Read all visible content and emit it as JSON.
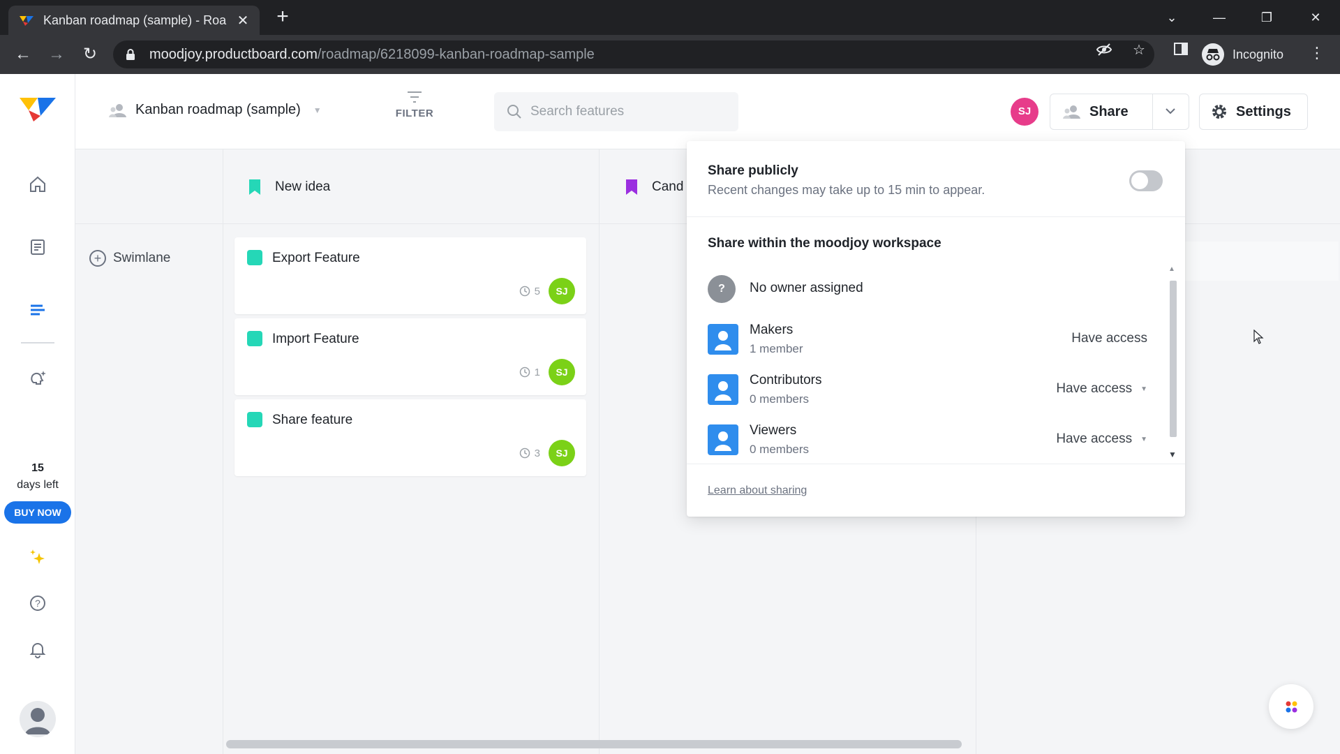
{
  "browser": {
    "tab_title": "Kanban roadmap (sample) - Roa",
    "url_host": "moodjoy.productboard.com",
    "url_path": "/roadmap/6218099-kanban-roadmap-sample",
    "incognito_label": "Incognito"
  },
  "sidebar": {
    "trial_days": "15",
    "trial_left": "days left",
    "buy_now": "BUY NOW"
  },
  "header": {
    "roadmap_title": "Kanban roadmap (sample)",
    "filter_label": "FILTER",
    "search_placeholder": "Search features",
    "avatar_initials": "SJ",
    "share_label": "Share",
    "settings_label": "Settings"
  },
  "board": {
    "add_swimlane": "Swimlane",
    "columns": [
      {
        "label": "New idea",
        "color": "#25d7b7"
      },
      {
        "label": "Cand",
        "color": "#9b2fe0"
      }
    ],
    "cards": [
      {
        "title": "Export Feature",
        "count": "5",
        "avatar": "SJ"
      },
      {
        "title": "Import Feature",
        "count": "1",
        "avatar": "SJ"
      },
      {
        "title": "Share feature",
        "count": "3",
        "avatar": "SJ"
      }
    ]
  },
  "share_popover": {
    "public_title": "Share publicly",
    "public_sub": "Recent changes may take up to 15 min to appear.",
    "public_enabled": false,
    "workspace_title": "Share within the moodjoy workspace",
    "owner": {
      "icon": "?",
      "label": "No owner assigned"
    },
    "groups": [
      {
        "name": "Makers",
        "count": "1 member",
        "access": "Have access"
      },
      {
        "name": "Contributors",
        "count": "0 members",
        "access": "Have access"
      },
      {
        "name": "Viewers",
        "count": "0 members",
        "access": "Have access"
      }
    ],
    "learn_link": "Learn about sharing"
  }
}
